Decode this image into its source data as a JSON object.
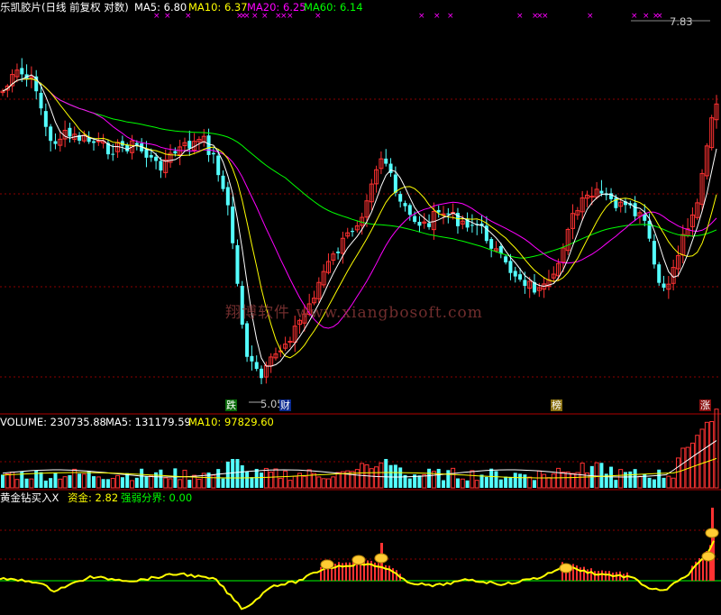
{
  "header": {
    "title": "乐凯胶片(日线 前复权 对数)",
    "ma5": "MA5: 6.80",
    "ma10": "MA10: 6.37",
    "ma20": "MA20: 6.25",
    "ma60": "MA60: 6.14",
    "price_top": "7.83",
    "price_low": "5.05"
  },
  "volume_panel": {
    "label": "VOLUME: 230735.88",
    "ma5": "MA5: 131179.59",
    "ma10": "MA10: 97829.60"
  },
  "indicator_panel": {
    "label": "黄金钻买入X",
    "fund": "资金: 2.82",
    "divide": "强弱分界: 0.00"
  },
  "markers": {
    "fall": "跌",
    "wealth": "财",
    "list": "榜",
    "rise": "涨"
  },
  "watermark": "翔博软件 www.xiangbosoft.com",
  "colors": {
    "up": "#ff3232",
    "down": "#54ffff",
    "ma5": "#ffffff",
    "ma10": "#ffff00",
    "ma20": "#ff00ff",
    "ma60": "#00ff00",
    "grid": "#8b0000",
    "fund_line": "#ffff00",
    "divider": "#00ff00"
  },
  "chart_data": [
    {
      "type": "candlestick",
      "title": "乐凯胶片(日线 前复权 对数)",
      "scale": "log",
      "series": [
        {
          "name": "MA5",
          "last": 6.8
        },
        {
          "name": "MA10",
          "last": 6.37
        },
        {
          "name": "MA20",
          "last": 6.25
        },
        {
          "name": "MA60",
          "last": 6.14
        }
      ],
      "annotations": {
        "high": 7.83,
        "low": 5.05
      },
      "grid": true
    },
    {
      "type": "bar",
      "title": "VOLUME",
      "last_volume": 230735.88,
      "series": [
        {
          "name": "MA5",
          "last": 131179.59
        },
        {
          "name": "MA10",
          "last": 97829.6
        }
      ]
    },
    {
      "type": "line",
      "title": "黄金钻买入X",
      "series": [
        {
          "name": "资金",
          "last": 2.82
        },
        {
          "name": "强弱分界",
          "last": 0.0
        }
      ]
    }
  ]
}
